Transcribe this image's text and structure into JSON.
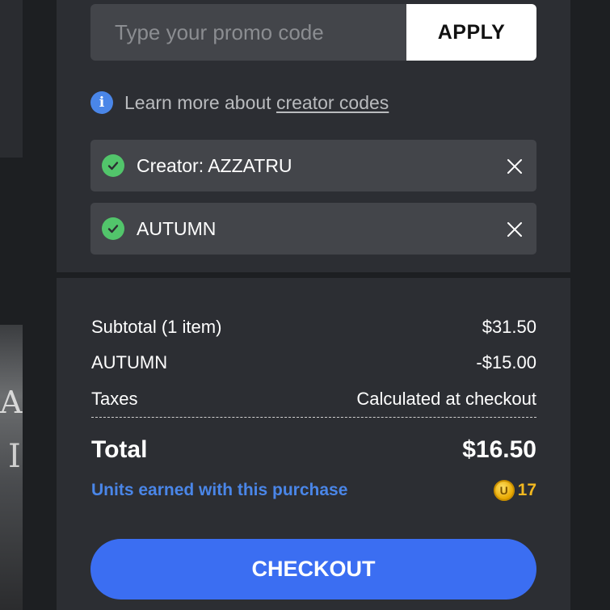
{
  "promo": {
    "placeholder": "Type your promo code",
    "value": "",
    "apply_label": "APPLY"
  },
  "learn_more": {
    "prefix": "Learn more about ",
    "link": "creator codes",
    "icon": "info-icon"
  },
  "applied_codes": [
    {
      "label": "Creator: AZZATRU",
      "icon": "check-icon"
    },
    {
      "label": "AUTUMN",
      "icon": "check-icon"
    }
  ],
  "summary": {
    "subtotal_label": "Subtotal (1 item)",
    "subtotal_value": "$31.50",
    "discount_label": "AUTUMN",
    "discount_value": "-$15.00",
    "taxes_label": "Taxes",
    "taxes_value": "Calculated at checkout",
    "total_label": "Total",
    "total_value": "$16.50",
    "units_label": "Units earned with this purchase",
    "units_value": "17"
  },
  "checkout_label": "CHECKOUT",
  "colors": {
    "accent_blue": "#3b6ef2",
    "units_blue": "#4a86e8",
    "check_green": "#52c56b",
    "coin_gold": "#f2b820",
    "panel": "#2c2e33"
  }
}
